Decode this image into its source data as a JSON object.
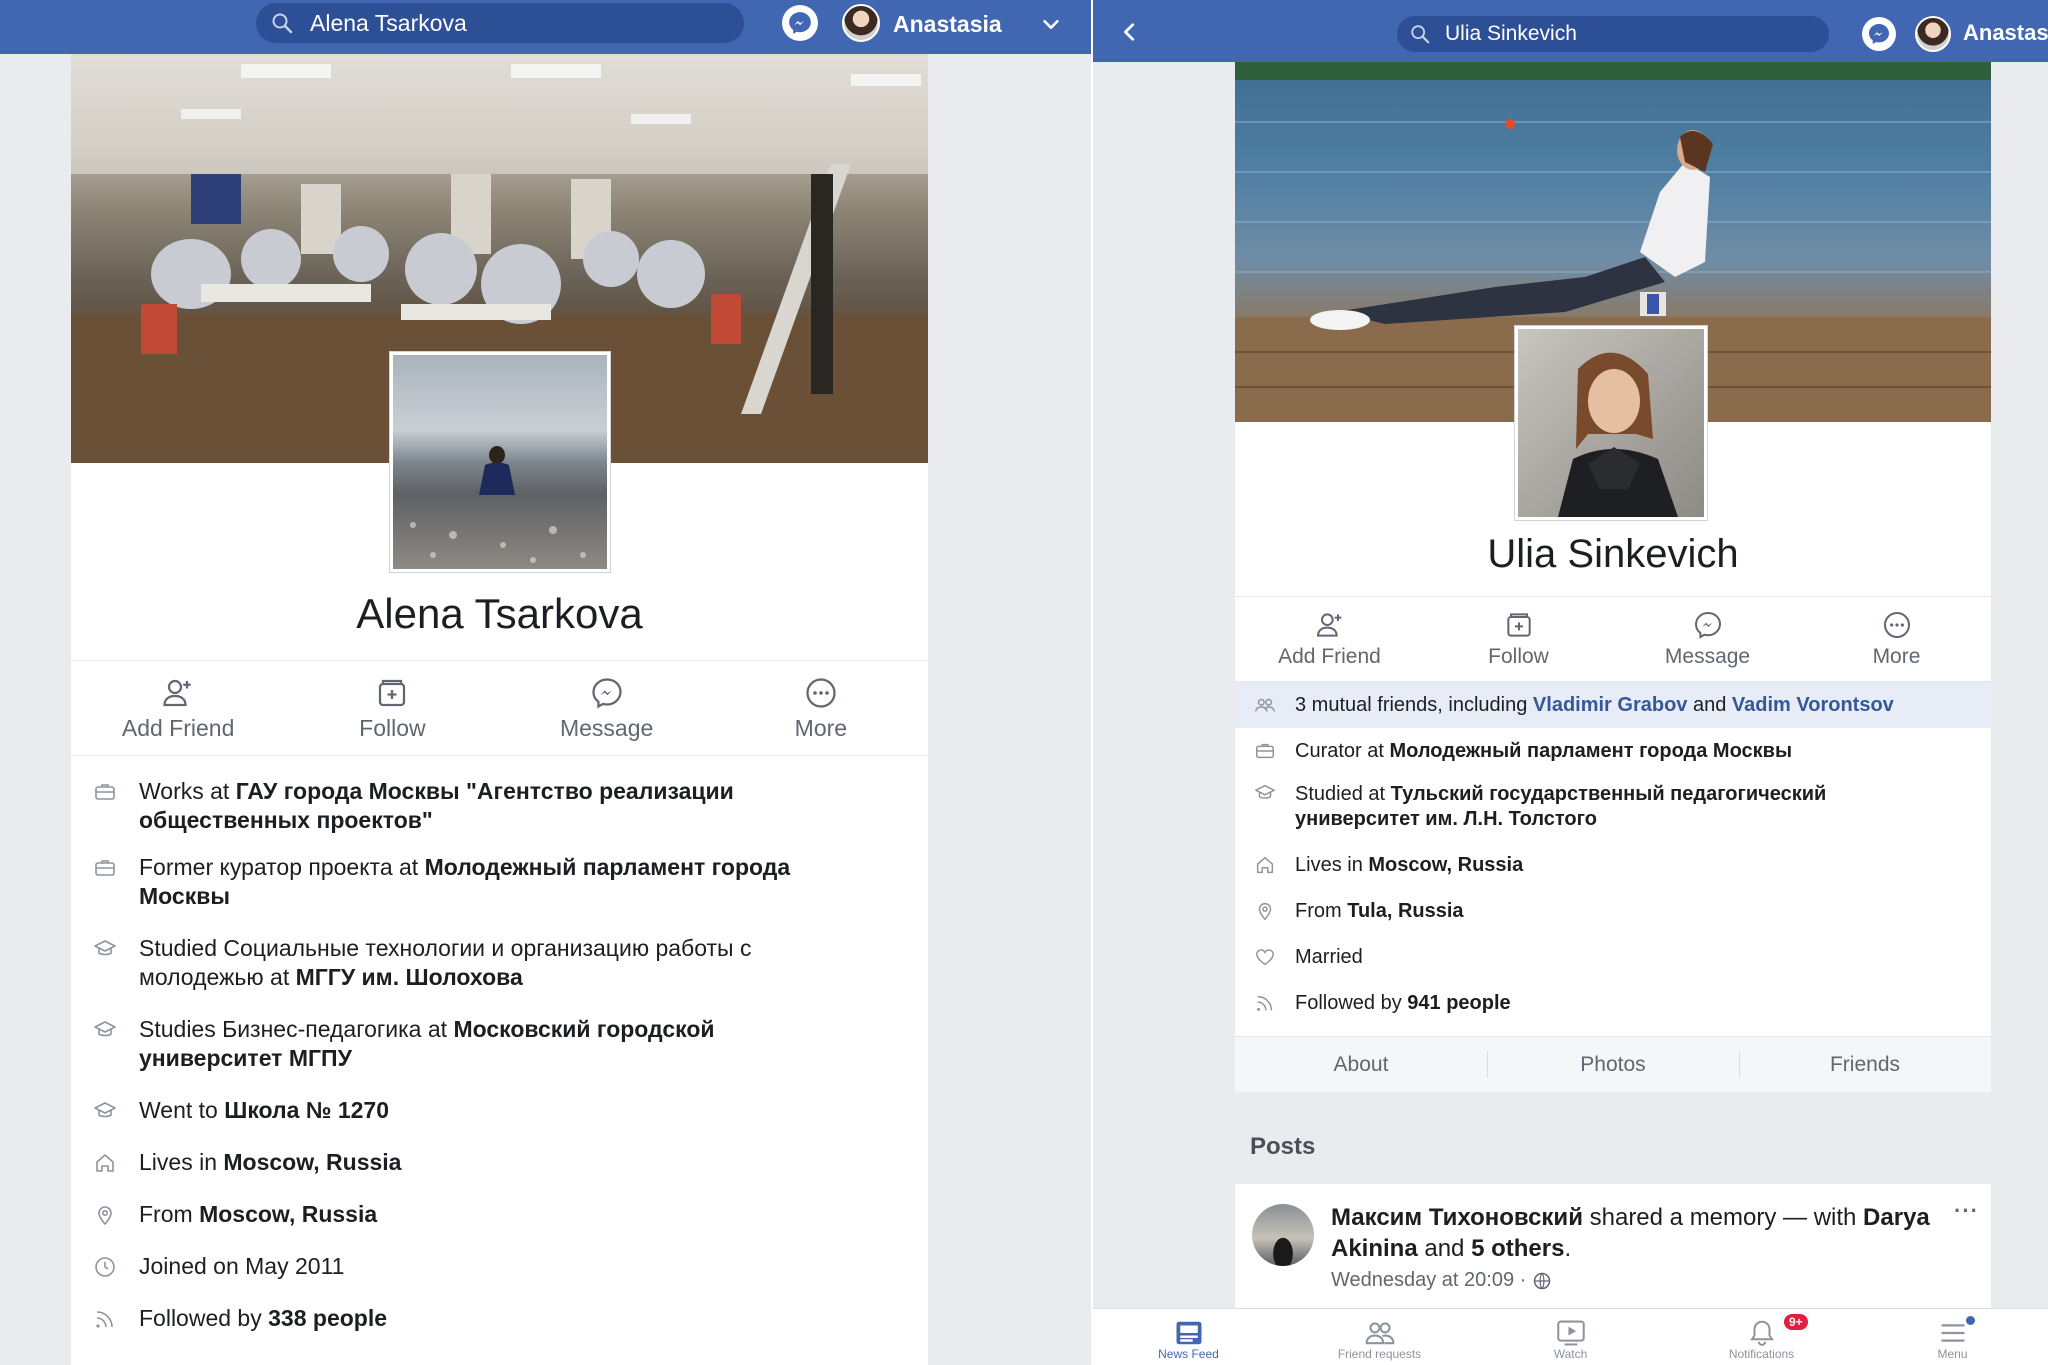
{
  "left": {
    "search_query": "Alena Tsarkova",
    "user_name": "Anastasia",
    "profile_name": "Alena Tsarkova",
    "actions": [
      "Add Friend",
      "Follow",
      "Message",
      "More"
    ],
    "info": [
      {
        "icon": "briefcase-icon",
        "pre": "Works at ",
        "bold": "ГАУ города Москвы \"Агентство реализации общественных проектов\"",
        "post": ""
      },
      {
        "icon": "briefcase-icon",
        "pre": "Former куратор проекта at ",
        "bold": "Молодежный парламент города Москвы",
        "post": ""
      },
      {
        "icon": "graduation-cap-icon",
        "pre": "Studied Социальные технологии и организацию работы с молодежью at ",
        "bold": "МГГУ им. Шолохова",
        "post": ""
      },
      {
        "icon": "graduation-cap-icon",
        "pre": "Studies Бизнес-педагогика at ",
        "bold": "Московский городской университет МГПУ",
        "post": ""
      },
      {
        "icon": "graduation-cap-icon",
        "pre": "Went to ",
        "bold": "Школа № 1270",
        "post": ""
      },
      {
        "icon": "home-icon",
        "pre": "Lives in ",
        "bold": "Moscow, Russia",
        "post": ""
      },
      {
        "icon": "location-pin-icon",
        "pre": "From ",
        "bold": "Moscow, Russia",
        "post": ""
      },
      {
        "icon": "clock-icon",
        "pre": "Joined on May 2011",
        "bold": "",
        "post": ""
      },
      {
        "icon": "rss-icon",
        "pre": "Followed by ",
        "bold": "338 people",
        "post": ""
      }
    ]
  },
  "right": {
    "search_query": "Ulia  Sinkevich",
    "user_name": "Anastasia",
    "profile_name": "Ulia  Sinkevich",
    "actions": [
      "Add Friend",
      "Follow",
      "Message",
      "More"
    ],
    "mutual": {
      "pre": "3 mutual friends, including ",
      "friend1": "Vladimir Grabov",
      "mid": " and ",
      "friend2": "Vadim Vorontsov"
    },
    "info": [
      {
        "icon": "briefcase-icon",
        "pre": "Curator at ",
        "bold": "Молодежный парламент города Москвы"
      },
      {
        "icon": "graduation-cap-icon",
        "pre": "Studied at ",
        "bold": "Тульский государственный педагогический университет  им. Л.Н. Толстого"
      },
      {
        "icon": "home-icon",
        "pre": "Lives in ",
        "bold": "Moscow, Russia"
      },
      {
        "icon": "location-pin-icon",
        "pre": "From ",
        "bold": "Tula, Russia"
      },
      {
        "icon": "heart-icon",
        "pre": "Married",
        "bold": ""
      },
      {
        "icon": "rss-icon",
        "pre": "Followed by ",
        "bold": "941 people"
      }
    ],
    "subtabs": [
      "About",
      "Photos",
      "Friends"
    ],
    "posts_heading": "Posts",
    "post": {
      "author": "Максим Тихоновский",
      "action": " shared a memory — with",
      "tagged": "Darya  Akinina",
      "and": " and ",
      "others": "5 others",
      "period": ".",
      "time": "Wednesday at 20:09 ·",
      "more": "···"
    },
    "bottom_nav": [
      {
        "label": "News Feed",
        "icon": "news-feed-icon",
        "active": true
      },
      {
        "label": "Friend requests",
        "icon": "friends-icon",
        "active": false
      },
      {
        "label": "Watch",
        "icon": "watch-icon",
        "active": false
      },
      {
        "label": "Notifications",
        "icon": "bell-icon",
        "active": false,
        "badge": "9+"
      },
      {
        "label": "Menu",
        "icon": "hamburger-icon",
        "active": false
      }
    ]
  },
  "colors": {
    "brand": "#4267b2",
    "link": "#365899",
    "badge": "#e41e3f"
  }
}
